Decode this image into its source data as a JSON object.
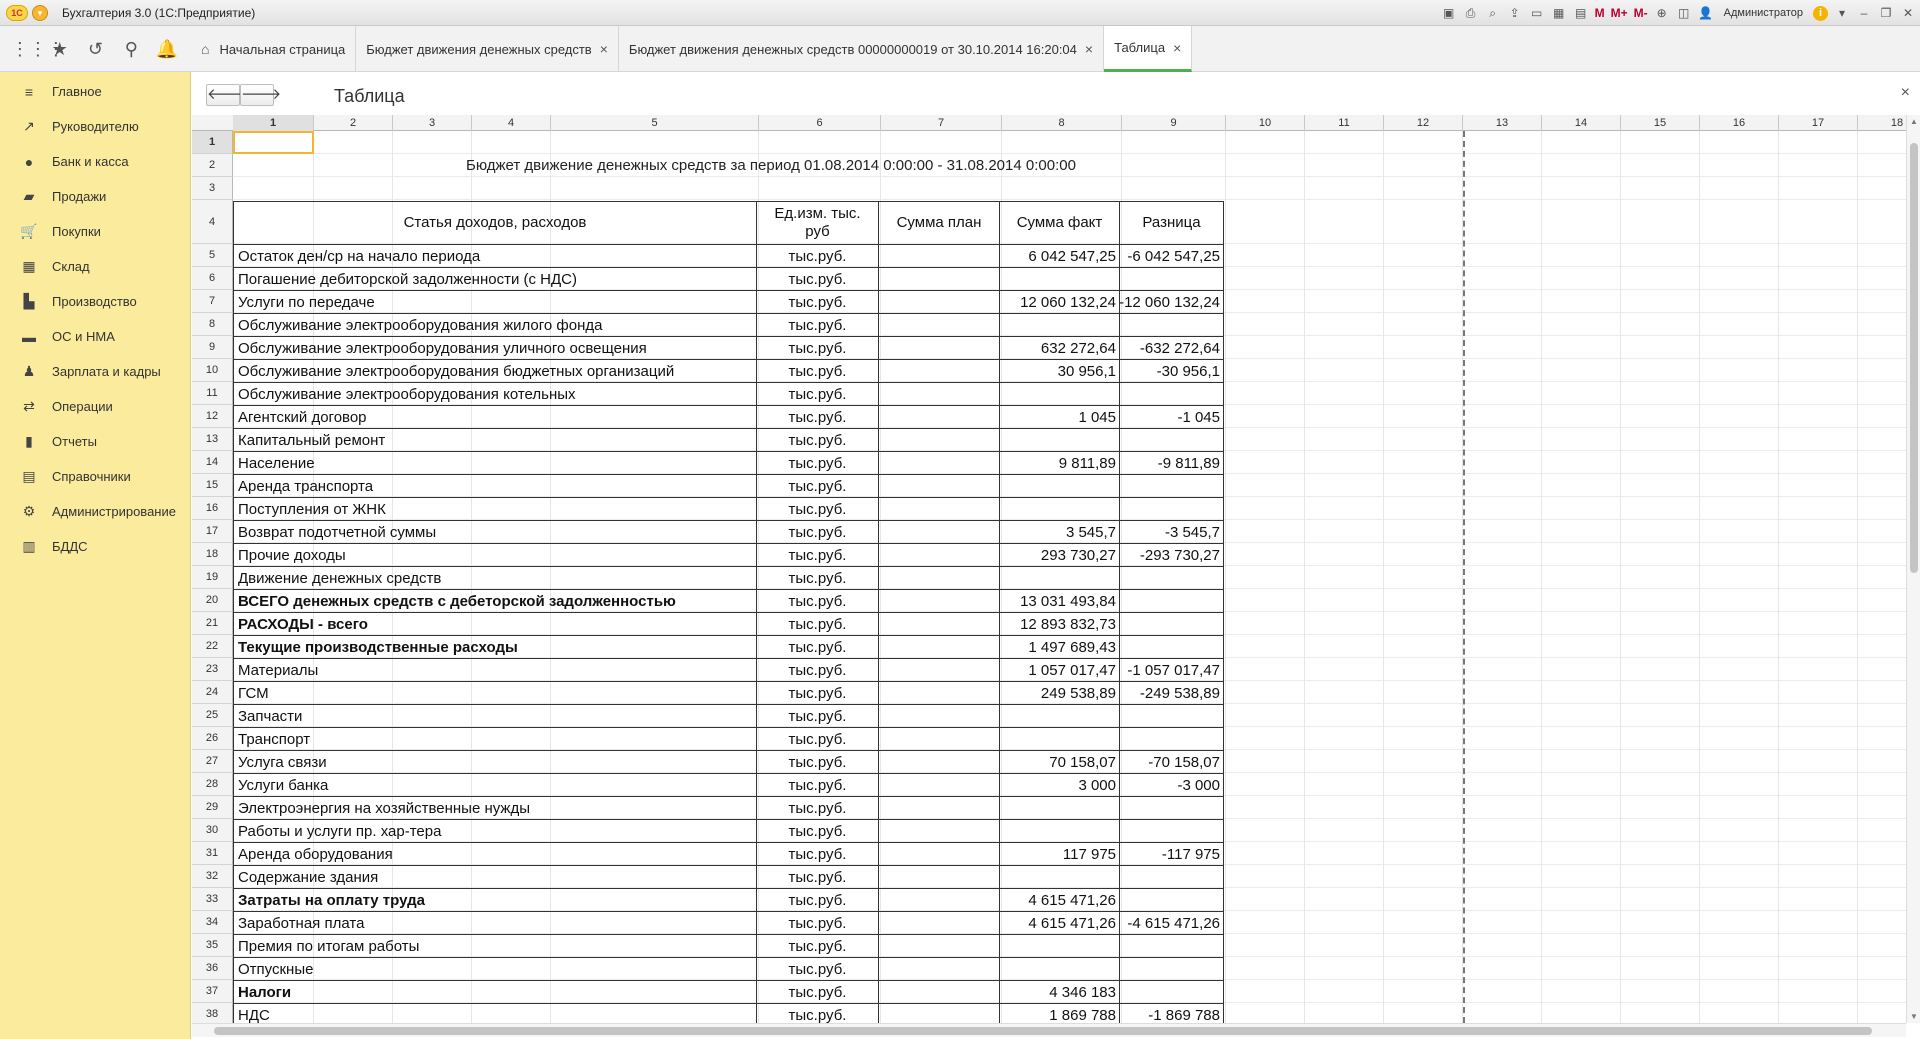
{
  "window": {
    "logo": "1С",
    "title": "Бухгалтерия 3.0  (1С:Предприятие)",
    "user": "Администратор",
    "m_labels": [
      "M",
      "M+",
      "M-"
    ]
  },
  "tabs": [
    {
      "label": "Начальная страница",
      "icon": "home-icon",
      "closable": false
    },
    {
      "label": "Бюджет движения денежных средств",
      "closable": true
    },
    {
      "label": "Бюджет движения денежных средств 00000000019 от 30.10.2014 16:20:04",
      "closable": true
    },
    {
      "label": "Таблица",
      "closable": true,
      "active": true
    }
  ],
  "sidebar": {
    "items": [
      {
        "label": "Главное",
        "icon": "menu-icon"
      },
      {
        "label": "Руководителю",
        "icon": "trend-icon"
      },
      {
        "label": "Банк и касса",
        "icon": "coin-icon"
      },
      {
        "label": "Продажи",
        "icon": "bag-icon"
      },
      {
        "label": "Покупки",
        "icon": "cart-icon"
      },
      {
        "label": "Склад",
        "icon": "warehouse-icon"
      },
      {
        "label": "Производство",
        "icon": "factory-icon"
      },
      {
        "label": "ОС и НМА",
        "icon": "truck-icon"
      },
      {
        "label": "Зарплата и кадры",
        "icon": "person-icon"
      },
      {
        "label": "Операции",
        "icon": "operations-icon"
      },
      {
        "label": "Отчеты",
        "icon": "chart-icon"
      },
      {
        "label": "Справочники",
        "icon": "book-icon"
      },
      {
        "label": "Администрирование",
        "icon": "gear-icon"
      },
      {
        "label": "БДДС",
        "icon": "budget-icon"
      }
    ]
  },
  "form": {
    "title": "Таблица",
    "back_glyph": "🡐",
    "forward_glyph": "🡒",
    "close_glyph": "×"
  },
  "sheet": {
    "column_numbers": [
      "1",
      "2",
      "3",
      "4",
      "5",
      "6",
      "7",
      "8",
      "9",
      "10",
      "11",
      "12",
      "13",
      "14",
      "15",
      "16",
      "17",
      "18"
    ],
    "row_numbers": [
      "1",
      "2",
      "3",
      "4",
      "5",
      "6",
      "7",
      "8",
      "9",
      "10",
      "11",
      "12",
      "13",
      "14",
      "15",
      "16",
      "17",
      "18",
      "19",
      "20",
      "21",
      "22",
      "23",
      "24",
      "25",
      "26",
      "27",
      "28",
      "29",
      "30",
      "31",
      "32",
      "33",
      "34",
      "35",
      "36",
      "37",
      "38"
    ],
    "report_title": "Бюджет движение денежных средств за период 01.08.2014 0:00:00 - 31.08.2014 0:00:00",
    "headers": [
      "Статья доходов, расходов",
      "Ед.изм. тыс. руб",
      "Сумма план",
      "Сумма факт",
      "Разница"
    ],
    "rows": [
      {
        "item": "Остаток ден/ср на начало периода",
        "unit": "тыс.руб.",
        "plan": "",
        "fact": "6 042 547,25",
        "diff": "-6 042 547,25",
        "bold": false
      },
      {
        "item": "Погашение дебиторской задолженности (с НДС)",
        "unit": "тыс.руб.",
        "plan": "",
        "fact": "",
        "diff": "",
        "bold": false
      },
      {
        "item": "Услуги по передаче",
        "unit": "тыс.руб.",
        "plan": "",
        "fact": "12 060 132,24",
        "diff": "-12 060 132,24",
        "bold": false
      },
      {
        "item": "Обслуживание электрооборудования жилого фонда",
        "unit": "тыс.руб.",
        "plan": "",
        "fact": "",
        "diff": "",
        "bold": false
      },
      {
        "item": "Обслуживание электрооборудования уличного освещения",
        "unit": "тыс.руб.",
        "plan": "",
        "fact": "632 272,64",
        "diff": "-632 272,64",
        "bold": false
      },
      {
        "item": "Обслуживание электрооборудования бюджетных организаций",
        "unit": "тыс.руб.",
        "plan": "",
        "fact": "30 956,1",
        "diff": "-30 956,1",
        "bold": false
      },
      {
        "item": "Обслуживание электрооборудования котельных",
        "unit": "тыс.руб.",
        "plan": "",
        "fact": "",
        "diff": "",
        "bold": false
      },
      {
        "item": "Агентский договор",
        "unit": "тыс.руб.",
        "plan": "",
        "fact": "1 045",
        "diff": "-1 045",
        "bold": false
      },
      {
        "item": "Капитальный ремонт",
        "unit": "тыс.руб.",
        "plan": "",
        "fact": "",
        "diff": "",
        "bold": false
      },
      {
        "item": "Население",
        "unit": "тыс.руб.",
        "plan": "",
        "fact": "9 811,89",
        "diff": "-9 811,89",
        "bold": false
      },
      {
        "item": "Аренда транспорта",
        "unit": "тыс.руб.",
        "plan": "",
        "fact": "",
        "diff": "",
        "bold": false
      },
      {
        "item": "Поступления от ЖНК",
        "unit": "тыс.руб.",
        "plan": "",
        "fact": "",
        "diff": "",
        "bold": false
      },
      {
        "item": "Возврат подотчетной суммы",
        "unit": "тыс.руб.",
        "plan": "",
        "fact": "3 545,7",
        "diff": "-3 545,7",
        "bold": false
      },
      {
        "item": "Прочие доходы",
        "unit": "тыс.руб.",
        "plan": "",
        "fact": "293 730,27",
        "diff": "-293 730,27",
        "bold": false
      },
      {
        "item": "Движение денежных средств",
        "unit": "тыс.руб.",
        "plan": "",
        "fact": "",
        "diff": "",
        "bold": false
      },
      {
        "item": "ВСЕГО денежных средств с дебеторской задолженностью",
        "unit": "тыс.руб.",
        "plan": "",
        "fact": "13 031 493,84",
        "diff": "",
        "bold": true
      },
      {
        "item": "РАСХОДЫ - всего",
        "unit": "тыс.руб.",
        "plan": "",
        "fact": "12 893 832,73",
        "diff": "",
        "bold": true
      },
      {
        "item": "Текущие производственные расходы",
        "unit": "тыс.руб.",
        "plan": "",
        "fact": "1 497 689,43",
        "diff": "",
        "bold": true
      },
      {
        "item": "Материалы",
        "unit": "тыс.руб.",
        "plan": "",
        "fact": "1 057 017,47",
        "diff": "-1 057 017,47",
        "bold": false
      },
      {
        "item": "ГСМ",
        "unit": "тыс.руб.",
        "plan": "",
        "fact": "249 538,89",
        "diff": "-249 538,89",
        "bold": false
      },
      {
        "item": "Запчасти",
        "unit": "тыс.руб.",
        "plan": "",
        "fact": "",
        "diff": "",
        "bold": false
      },
      {
        "item": "Транспорт",
        "unit": "тыс.руб.",
        "plan": "",
        "fact": "",
        "diff": "",
        "bold": false
      },
      {
        "item": "Услуга связи",
        "unit": "тыс.руб.",
        "plan": "",
        "fact": "70 158,07",
        "diff": "-70 158,07",
        "bold": false
      },
      {
        "item": "Услуги банка",
        "unit": "тыс.руб.",
        "plan": "",
        "fact": "3 000",
        "diff": "-3 000",
        "bold": false
      },
      {
        "item": "Электроэнергия на хозяйственные нужды",
        "unit": "тыс.руб.",
        "plan": "",
        "fact": "",
        "diff": "",
        "bold": false
      },
      {
        "item": "Работы и услуги пр. хар-тера",
        "unit": "тыс.руб.",
        "plan": "",
        "fact": "",
        "diff": "",
        "bold": false
      },
      {
        "item": "Аренда оборудования",
        "unit": "тыс.руб.",
        "plan": "",
        "fact": "117 975",
        "diff": "-117 975",
        "bold": false
      },
      {
        "item": "Содержание здания",
        "unit": "тыс.руб.",
        "plan": "",
        "fact": "",
        "diff": "",
        "bold": false
      },
      {
        "item": "Затраты на оплату труда",
        "unit": "тыс.руб.",
        "plan": "",
        "fact": "4 615 471,26",
        "diff": "",
        "bold": true
      },
      {
        "item": "Заработная плата",
        "unit": "тыс.руб.",
        "plan": "",
        "fact": "4 615 471,26",
        "diff": "-4 615 471,26",
        "bold": false
      },
      {
        "item": "Премия по итогам работы",
        "unit": "тыс.руб.",
        "plan": "",
        "fact": "",
        "diff": "",
        "bold": false
      },
      {
        "item": "Отпускные",
        "unit": "тыс.руб.",
        "plan": "",
        "fact": "",
        "diff": "",
        "bold": false
      },
      {
        "item": "Налоги",
        "unit": "тыс.руб.",
        "plan": "",
        "fact": "4 346 183",
        "diff": "",
        "bold": true
      },
      {
        "item": "НДС",
        "unit": "тыс.руб.",
        "plan": "",
        "fact": "1 869 788",
        "diff": "-1 869 788",
        "bold": false
      }
    ]
  },
  "colors": {
    "sidebar_bg": "#fbeb9c",
    "active_tab_underline": "#4caf50",
    "selected_cell_border": "#f2b632"
  }
}
